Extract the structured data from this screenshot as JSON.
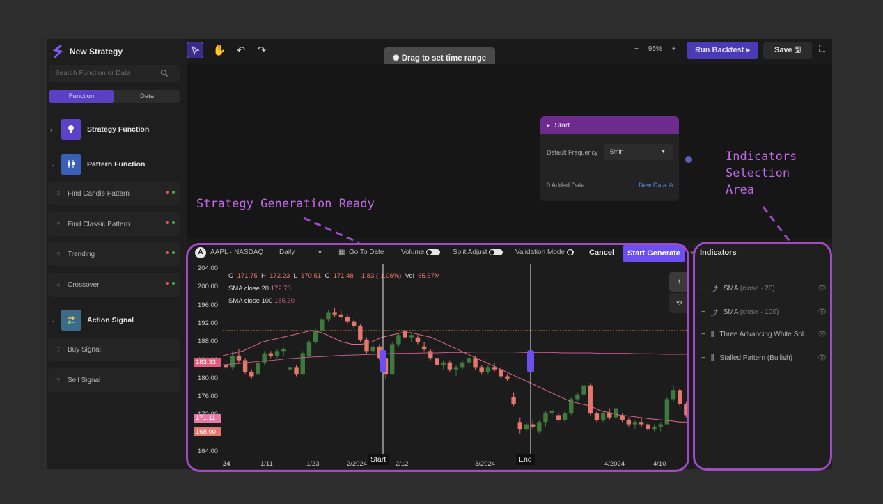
{
  "app": {
    "title": "New Strategy"
  },
  "sidebar": {
    "search_placeholder": "Search Function or Data",
    "tabs": [
      "Function",
      "Data"
    ],
    "groups": [
      {
        "label": "Strategy Function",
        "icon": "lightbulb-icon"
      },
      {
        "label": "Pattern Function",
        "icon": "candlestick-icon"
      },
      {
        "label": "Action Signal",
        "icon": "exchange-icon"
      }
    ],
    "items": [
      {
        "label": "Find Candle Pattern"
      },
      {
        "label": "Find Classic Pattern"
      },
      {
        "label": "Trending"
      },
      {
        "label": "Crossover"
      },
      {
        "label": "Buy Signal"
      },
      {
        "label": "Sell Signal"
      }
    ]
  },
  "toolbar": {
    "zoom_minus": "−",
    "zoom_level": "95%",
    "zoom_plus": "+",
    "run_label": "Run Backtest ▸",
    "save_label": "Save 🖫"
  },
  "tooltip": {
    "text": "Drag to set time range"
  },
  "node": {
    "title": "Start",
    "freq_label": "Default Frequency",
    "freq_value": "5min",
    "added_label": "0 Added Data",
    "new_data": "New Data"
  },
  "annotations": {
    "strategy": "Strategy Generation Ready",
    "indicators": "Indicators\nSelection\nArea"
  },
  "chart_toolbar": {
    "symbol_badge": "A",
    "symbol": "AAPL · NASDAQ",
    "interval": "Daily",
    "goto": "Go To Date",
    "volume": "Volume",
    "split": "Split Adjust",
    "validation": "Validation Mode",
    "cancel": "Cancel",
    "generate": "Start Generate"
  },
  "chart_legend": {
    "o_label": "O",
    "o": "171.75",
    "h_label": "H",
    "h": "172.23",
    "l_label": "L",
    "l": "170.51",
    "c_label": "C",
    "c": "171.48",
    "change": "-1.83 (-1.06%)",
    "vol_label": "Vol",
    "vol": "65.67M",
    "sma20_label": "SMA close 20",
    "sma20": "172.70",
    "sma100_label": "SMA close 100",
    "sma100": "185.30"
  },
  "price_tags": [
    "183.33",
    "171.11",
    "168.00"
  ],
  "right_controls": {
    "count": "4"
  },
  "markers": {
    "start": "Start",
    "end": "End"
  },
  "chart_data": {
    "type": "candlestick",
    "y_ticks": [
      "204.00",
      "200.00",
      "196.00",
      "192.00",
      "188.00",
      "184.00",
      "180.00",
      "176.00",
      "172.00",
      "168.00",
      "164.00"
    ],
    "x_ticks": [
      "24",
      "1/11",
      "1/23",
      "2/2024",
      "2/12",
      "3/2024",
      "4/2024",
      "4/10"
    ],
    "ylim": [
      164,
      204
    ],
    "series": [
      {
        "name": "SMA close 20",
        "color": "#e06a8a"
      },
      {
        "name": "SMA close 100",
        "color": "#c05a8a"
      }
    ],
    "sma20": [
      185,
      185.5,
      186,
      187,
      188,
      188.5,
      189,
      189.5,
      190,
      190.5,
      190,
      189,
      188,
      187.5,
      187.5,
      188,
      189,
      189.5,
      190,
      190,
      189.5,
      189,
      188,
      187,
      186,
      185,
      184,
      183,
      182,
      181,
      180,
      179,
      178,
      177,
      176,
      175,
      174.5,
      174,
      173,
      172.5,
      172,
      171.8,
      171.5,
      171.2,
      171,
      170.8,
      170.5,
      170.5
    ],
    "sma100": [
      183,
      183.2,
      183.5,
      183.8,
      184,
      184.3,
      184.5,
      184.7,
      184.8,
      185,
      185.1,
      185.2,
      185.3,
      185.4,
      185.5,
      185.5,
      185.6,
      185.6,
      185.7,
      185.7,
      185.8,
      185.8,
      185.8,
      185.8,
      185.7,
      185.7,
      185.7,
      185.6,
      185.6,
      185.6,
      185.5,
      185.5,
      185.5,
      185.4,
      185.4,
      185.3,
      185.3,
      185.3
    ],
    "candles": [
      [
        183,
        184,
        181.5,
        182.5
      ],
      [
        182.5,
        186,
        182,
        185
      ],
      [
        185,
        186.5,
        183.5,
        184
      ],
      [
        184,
        184.5,
        181,
        181.5
      ],
      [
        181.5,
        182,
        180,
        180.5
      ],
      [
        181,
        184,
        180.5,
        183.5
      ],
      [
        183.5,
        186,
        183,
        185.5
      ],
      [
        185.5,
        186,
        184.5,
        185
      ],
      [
        185,
        186.5,
        184.5,
        186
      ],
      [
        186,
        187,
        185,
        186.5
      ],
      [
        182,
        183,
        181.5,
        182.5
      ],
      [
        182.5,
        183,
        180.5,
        181
      ],
      [
        181,
        186,
        181,
        185.5
      ],
      [
        185,
        188.5,
        184.5,
        188
      ],
      [
        188,
        191,
        187.5,
        190.5
      ],
      [
        190.5,
        193.5,
        190,
        193
      ],
      [
        193,
        195,
        192.5,
        194.5
      ],
      [
        194.5,
        195.5,
        193.5,
        194
      ],
      [
        194,
        195,
        193,
        193.5
      ],
      [
        193.5,
        194,
        192,
        192.5
      ],
      [
        192.5,
        193,
        191,
        191.5
      ],
      [
        191.5,
        192,
        188,
        188.5
      ],
      [
        188.5,
        189,
        185.5,
        186
      ],
      [
        186,
        187.5,
        185,
        187
      ],
      [
        187,
        187.5,
        184,
        184.5
      ],
      [
        184.5,
        185,
        180,
        181
      ],
      [
        181,
        188,
        181,
        187.5
      ],
      [
        187.5,
        190,
        187,
        189.5
      ],
      [
        190.5,
        191,
        188.5,
        189
      ],
      [
        189,
        190,
        188,
        189.5
      ],
      [
        189,
        189.5,
        187.5,
        188
      ],
      [
        187,
        188,
        186,
        186.5
      ],
      [
        186,
        186.5,
        184,
        184.5
      ],
      [
        184.5,
        185,
        182.5,
        183
      ],
      [
        183,
        184,
        182,
        183.5
      ],
      [
        183.5,
        184,
        181.5,
        182
      ],
      [
        182,
        183,
        180.5,
        182.5
      ],
      [
        182.5,
        184,
        182,
        183.5
      ],
      [
        183.5,
        185,
        182.5,
        184.5
      ],
      [
        184.5,
        185,
        182,
        182.5
      ],
      [
        182.5,
        183,
        181,
        181.5
      ],
      [
        181.5,
        183,
        181,
        182.5
      ],
      [
        182.5,
        183.5,
        181.5,
        182
      ],
      [
        182,
        182.5,
        180,
        180.5
      ],
      [
        180.5,
        181,
        179.5,
        180
      ],
      [
        176,
        177,
        174,
        174.5
      ],
      [
        170.5,
        171.5,
        168,
        169
      ],
      [
        169,
        170.5,
        168.5,
        170
      ],
      [
        170,
        171,
        169,
        169.5
      ],
      [
        168.5,
        171,
        168,
        170.5
      ],
      [
        170.5,
        173,
        169.5,
        172.5
      ],
      [
        172.5,
        173.5,
        171.5,
        173
      ],
      [
        172,
        172.5,
        170.5,
        171
      ],
      [
        171,
        173,
        170.5,
        172.5
      ],
      [
        172.5,
        176,
        172,
        175.5
      ],
      [
        175.5,
        177,
        175,
        176.5
      ],
      [
        176.5,
        179,
        176,
        178.5
      ],
      [
        178.5,
        179,
        172,
        172.5
      ],
      [
        172.5,
        173,
        170.5,
        171
      ],
      [
        171,
        173,
        170.5,
        172.5
      ],
      [
        172.5,
        173.5,
        171,
        171.5
      ],
      [
        171.5,
        174,
        171,
        173.5
      ],
      [
        172,
        172.5,
        170.5,
        171
      ],
      [
        171,
        171.5,
        169.5,
        170
      ],
      [
        170,
        171,
        169,
        170.5
      ],
      [
        170.5,
        171.5,
        169.5,
        170
      ],
      [
        170,
        170.5,
        168.5,
        169
      ],
      [
        169,
        170,
        168.5,
        169.5
      ],
      [
        169.5,
        170.5,
        168.5,
        170
      ],
      [
        170,
        176,
        170,
        175.5
      ],
      [
        175.5,
        178.5,
        175,
        177.5
      ],
      [
        177.5,
        178,
        174,
        174.5
      ],
      [
        174.5,
        175,
        171.5,
        172
      ]
    ]
  },
  "indicators": {
    "title": "Indicators",
    "items": [
      {
        "label": "SMA",
        "params": "(close · 20)",
        "icon": "line-chart-icon"
      },
      {
        "label": "SMA",
        "params": "(close · 100)",
        "icon": "line-chart-icon"
      },
      {
        "label": "Three Advancing White Sol...",
        "params": "",
        "icon": "candlestick-icon"
      },
      {
        "label": "Stalled Pattern (Bullish)",
        "params": "",
        "icon": "candlestick-icon"
      }
    ]
  },
  "colors": {
    "accent": "#6b4ff0",
    "up": "#3e7a3e",
    "down": "#e5776d",
    "annotation": "#a04bc5"
  }
}
